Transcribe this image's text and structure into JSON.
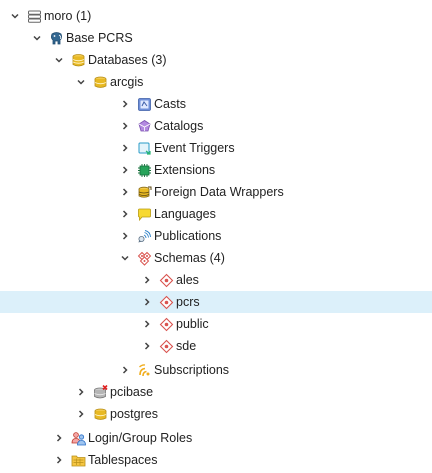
{
  "tree": {
    "server_group": {
      "label": "moro (1)",
      "icon": "server-group-icon",
      "expanded": true
    },
    "server": {
      "label": "Base PCRS",
      "icon": "postgres-elephant-icon",
      "expanded": true
    },
    "databases": {
      "label": "Databases (3)",
      "icon": "databases-icon",
      "expanded": true
    },
    "db_arcgis": {
      "label": "arcgis",
      "icon": "database-icon",
      "expanded": true
    },
    "casts": {
      "label": "Casts",
      "icon": "casts-icon"
    },
    "catalogs": {
      "label": "Catalogs",
      "icon": "catalogs-icon"
    },
    "event_triggers": {
      "label": "Event Triggers",
      "icon": "event-triggers-icon"
    },
    "extensions": {
      "label": "Extensions",
      "icon": "extensions-icon"
    },
    "fdw": {
      "label": "Foreign Data Wrappers",
      "icon": "foreign-data-wrappers-icon"
    },
    "languages": {
      "label": "Languages",
      "icon": "languages-icon"
    },
    "publications": {
      "label": "Publications",
      "icon": "publications-icon"
    },
    "schemas": {
      "label": "Schemas (4)",
      "icon": "schemas-icon",
      "expanded": true
    },
    "schema_ales": {
      "label": "ales",
      "icon": "schema-icon"
    },
    "schema_pcrs": {
      "label": "pcrs",
      "icon": "schema-icon",
      "selected": true
    },
    "schema_public": {
      "label": "public",
      "icon": "schema-icon"
    },
    "schema_sde": {
      "label": "sde",
      "icon": "schema-icon"
    },
    "subscriptions": {
      "label": "Subscriptions",
      "icon": "subscriptions-icon"
    },
    "db_pcibase": {
      "label": "pcibase",
      "icon": "database-disconnected-icon"
    },
    "db_postgres": {
      "label": "postgres",
      "icon": "database-icon"
    },
    "login_roles": {
      "label": "Login/Group Roles",
      "icon": "login-group-roles-icon"
    },
    "tablespaces": {
      "label": "Tablespaces",
      "icon": "tablespaces-icon"
    }
  },
  "colors": {
    "selected_row": "#dcf0fa",
    "chevron": "#444444",
    "db_gold": "#e8b923",
    "schema_red": "#d9534f",
    "postgres_blue": "#336791"
  }
}
